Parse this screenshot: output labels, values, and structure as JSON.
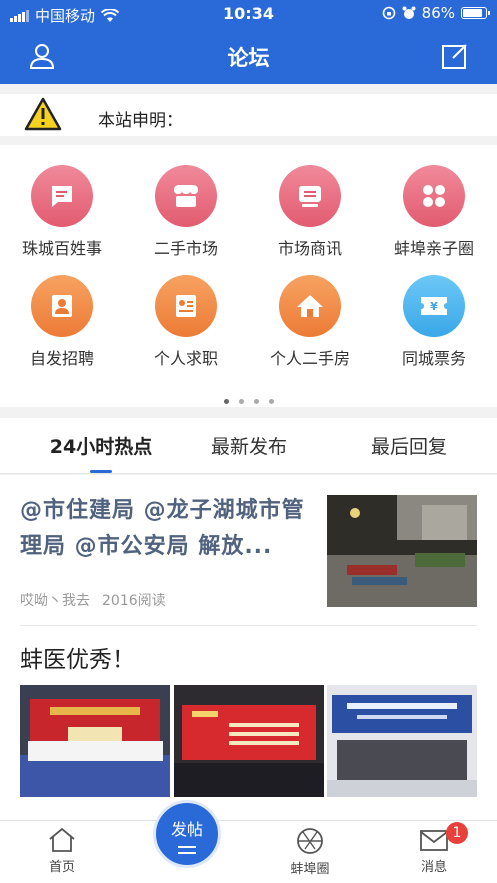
{
  "status_bar": {
    "carrier": "中国移动",
    "time": "10:34",
    "battery": "86%"
  },
  "nav": {
    "title": "论坛"
  },
  "notice": {
    "text": "本站申明："
  },
  "categories": [
    {
      "label": "珠城百姓事",
      "icon": "message-icon",
      "color": "#e25b70"
    },
    {
      "label": "二手市场",
      "icon": "shop-icon",
      "color": "#e25b70"
    },
    {
      "label": "市场商讯",
      "icon": "screen-icon",
      "color": "#e25b70"
    },
    {
      "label": "蚌埠亲子圈",
      "icon": "clover-icon",
      "color": "#e25b70"
    },
    {
      "label": "自发招聘",
      "icon": "person-icon",
      "color": "#ec7b36"
    },
    {
      "label": "个人求职",
      "icon": "resume-icon",
      "color": "#ec7b36"
    },
    {
      "label": "个人二手房",
      "icon": "house-icon",
      "color": "#ec7b36"
    },
    {
      "label": "同城票务",
      "icon": "ticket-icon",
      "color": "#3aa7e8"
    }
  ],
  "pager": {
    "pages": 4,
    "current": 1
  },
  "tabs": [
    {
      "label": "24小时热点"
    },
    {
      "label": "最新发布"
    },
    {
      "label": "最后回复"
    }
  ],
  "posts": [
    {
      "title": "@市住建局 @龙子湖城市管理局 @市公安局  解放...",
      "author": "哎呦丶我去",
      "views": "2016阅读"
    },
    {
      "title": "蚌医优秀！"
    }
  ],
  "bottom_nav": {
    "home": "首页",
    "post": "发帖",
    "circle": "蚌埠圈",
    "messages": "消息",
    "message_badge": "1"
  },
  "accent_color": "#2a6ad8"
}
